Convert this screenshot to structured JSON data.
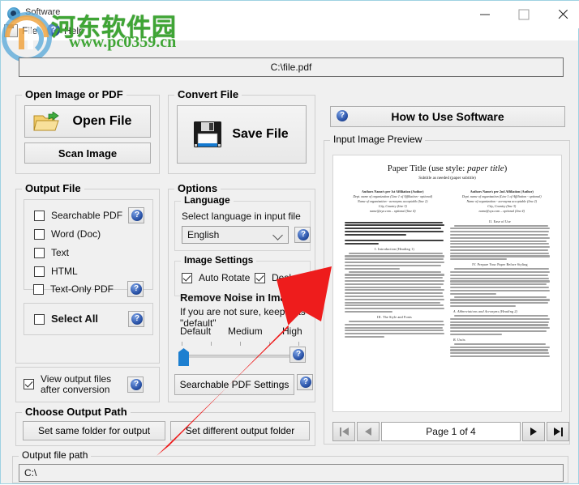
{
  "window": {
    "title": "Software",
    "minimize": "—",
    "maximize": "□",
    "close": "✕"
  },
  "menubar": {
    "file": "File",
    "help": "Help",
    "help_glyph": "?"
  },
  "watermark": {
    "chinese": "河东软件园",
    "url": "www.pc0359.cn"
  },
  "input_path": {
    "value": "C:\\file.pdf"
  },
  "open_group": {
    "legend": "Open Image or PDF",
    "open_file_button": "Open File",
    "scan_image_button": "Scan Image"
  },
  "convert_group": {
    "legend": "Convert File",
    "save_file_button": "Save File"
  },
  "output_file_group": {
    "legend": "Output File",
    "checkboxes": [
      {
        "label": "Searchable PDF",
        "checked": false,
        "help": true
      },
      {
        "label": "Word (Doc)",
        "checked": false,
        "help": false
      },
      {
        "label": "Text",
        "checked": false,
        "help": false
      },
      {
        "label": "HTML",
        "checked": false,
        "help": false
      },
      {
        "label": "Text-Only PDF",
        "checked": false,
        "help": true
      }
    ],
    "select_all": {
      "label": "Select All",
      "checked": false,
      "help": true
    },
    "view_output": {
      "line1": "View output files",
      "line2": "after conversion",
      "checked": true,
      "help": true
    }
  },
  "options_group": {
    "legend": "Options",
    "language": {
      "legend": "Language",
      "hint": "Select language in input file",
      "selected": "English",
      "options": [
        "English"
      ]
    },
    "image_settings": {
      "legend": "Image Settings",
      "auto_rotate": {
        "label": "Auto Rotate",
        "checked": true
      },
      "deskew": {
        "label": "Deskew",
        "checked": true
      }
    },
    "remove_noise": {
      "legend": "Remove Noise in Image",
      "hint": "If you are not sure, keep it as \"default\"",
      "ticks": [
        "Default",
        "Medium",
        "High"
      ],
      "value": 0
    },
    "searchable_pdf_settings_button": "Searchable PDF Settings"
  },
  "output_path_group": {
    "legend": "Choose Output Path",
    "same_folder_button": "Set same folder for output",
    "different_folder_button": "Set different output folder"
  },
  "output_file_path": {
    "legend": "Output file path",
    "value": "C:\\"
  },
  "right_panel": {
    "how_to_use_button": "How to Use Software",
    "preview_legend": "Input Image Preview",
    "page_indicator": "Page 1 of 4",
    "nav": {
      "first": "|◀",
      "prev": "◀",
      "next": "▶",
      "last": "▶|"
    },
    "document": {
      "title": "Paper Title (use style: paper title)",
      "subtitle": "Subtitle as needed (paper subtitle)",
      "author_left": [
        "Authors Name/s per 1st Affiliation (Author)",
        "Dept. name of organization (Line 1 of Affiliation - optional)",
        "Name of organization - acronyms acceptable (line 2)",
        "City, Country (line 3)",
        "name@xyz.com – optional (line 4)"
      ],
      "author_right": [
        "Authors Name/s per 2nd Affiliation (Author)",
        "Dept. name of organization (Line 1 of Affiliation - optional)",
        "Name of organization - acronyms acceptable (line 2)",
        "City, Country (line 3)",
        "name@xyz.com – optional (line 4)"
      ],
      "sections": [
        "I.  Introduction (Heading 1)",
        "II.  Ease of Use",
        "III.  The Style and Fonts",
        "IV.  Prepare Your Paper Before Styling",
        "A.  Abbreviations and Acronyms (Heading 2)",
        "B.  Units"
      ]
    }
  },
  "colors": {
    "window_background": "#f0f0f0",
    "window_border": "#9fd2e2",
    "watermark_green": "#3fa535",
    "annotation_red": "#ee1c1c",
    "slider_blue": "#1d7fd0",
    "help_blue": "#2a53a8"
  }
}
